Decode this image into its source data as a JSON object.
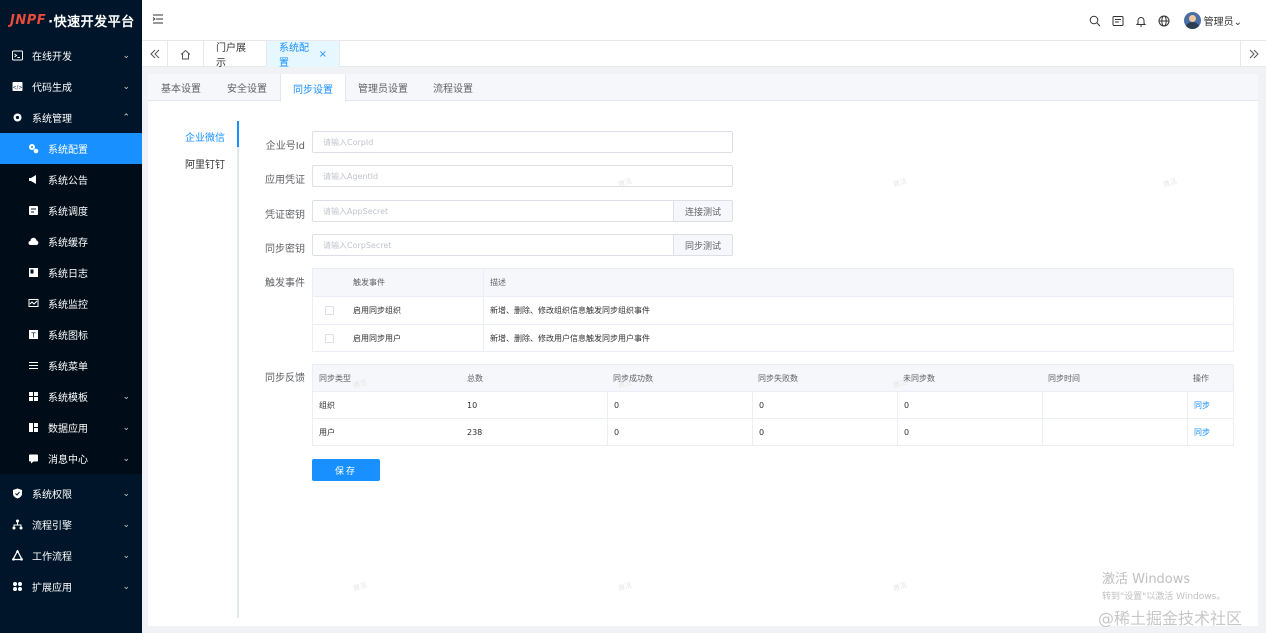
{
  "brand": {
    "logo_a": "JNPF",
    "logo_b": "·快速开发平台"
  },
  "sidebar": {
    "items": [
      {
        "label": "在线开发",
        "icon": "terminal-icon",
        "arrow": "⌄"
      },
      {
        "label": "代码生成",
        "icon": "code-icon",
        "arrow": "⌄"
      },
      {
        "label": "系统管理",
        "icon": "gear-icon",
        "arrow": "⌃"
      }
    ],
    "sub_items": [
      {
        "label": "系统配置",
        "icon": "gears-icon",
        "active": true
      },
      {
        "label": "系统公告",
        "icon": "megaphone-icon"
      },
      {
        "label": "系统调度",
        "icon": "schedule-icon"
      },
      {
        "label": "系统缓存",
        "icon": "cloud-icon"
      },
      {
        "label": "系统日志",
        "icon": "log-icon"
      },
      {
        "label": "系统监控",
        "icon": "monitor-icon"
      },
      {
        "label": "系统图标",
        "icon": "icon-icon"
      },
      {
        "label": "系统菜单",
        "icon": "menu-icon"
      },
      {
        "label": "系统模板",
        "icon": "template-icon",
        "arrow": "⌄"
      },
      {
        "label": "数据应用",
        "icon": "data-icon",
        "arrow": "⌄"
      },
      {
        "label": "消息中心",
        "icon": "message-icon",
        "arrow": "⌄"
      }
    ],
    "bottom_items": [
      {
        "label": "系统权限",
        "icon": "shield-icon",
        "arrow": "⌄"
      },
      {
        "label": "流程引擎",
        "icon": "flow-icon",
        "arrow": "⌄"
      },
      {
        "label": "工作流程",
        "icon": "workflow-icon",
        "arrow": "⌄"
      },
      {
        "label": "扩展应用",
        "icon": "apps-icon",
        "arrow": "⌄"
      }
    ]
  },
  "header": {
    "username": "管理员",
    "dropdown": "⌄"
  },
  "tabs": [
    {
      "label": "门户展示"
    },
    {
      "label": "系统配置",
      "close": "×"
    }
  ],
  "subtabs": [
    "基本设置",
    "安全设置",
    "同步设置",
    "管理员设置",
    "流程设置"
  ],
  "vtabs": [
    "企业微信",
    "阿里钉钉"
  ],
  "form": {
    "corp_id": {
      "label": "企业号Id",
      "placeholder": "请输入CorpId"
    },
    "agent_id": {
      "label": "应用凭证",
      "placeholder": "请输入AgentId"
    },
    "app_secret": {
      "label": "凭证密钥",
      "placeholder": "请输入AppSecret",
      "button": "连接测试"
    },
    "corp_secret": {
      "label": "同步密钥",
      "placeholder": "请输入CorpSecret",
      "button": "同步测试"
    },
    "trigger_label": "触发事件",
    "feedback_label": "同步反馈",
    "save": "保存"
  },
  "trigger_table": {
    "headers": [
      "触发事件",
      "描述"
    ],
    "rows": [
      {
        "event": "启用同步组织",
        "desc": "新增、删除、修改组织信息触发同步组织事件"
      },
      {
        "event": "启用同步用户",
        "desc": "新增、删除、修改用户信息触发同步用户事件"
      }
    ]
  },
  "feedback_table": {
    "headers": [
      "同步类型",
      "总数",
      "同步成功数",
      "同步失败数",
      "未同步数",
      "同步时间",
      "操作"
    ],
    "rows": [
      {
        "type": "组织",
        "total": "10",
        "success": "0",
        "fail": "0",
        "pending": "0",
        "time": "",
        "action": "同步"
      },
      {
        "type": "用户",
        "total": "238",
        "success": "0",
        "fail": "0",
        "pending": "0",
        "time": "",
        "action": "同步"
      }
    ]
  },
  "overlay": {
    "watermark": "激活",
    "win_title": "激活 Windows",
    "win_sub": "转到\"设置\"以激活 Windows。",
    "juejin": "@稀土掘金技术社区"
  },
  "colors": {
    "accent": "#1890ff",
    "sidebar_bg": "#001529",
    "logo_red": "#e74c3c"
  }
}
